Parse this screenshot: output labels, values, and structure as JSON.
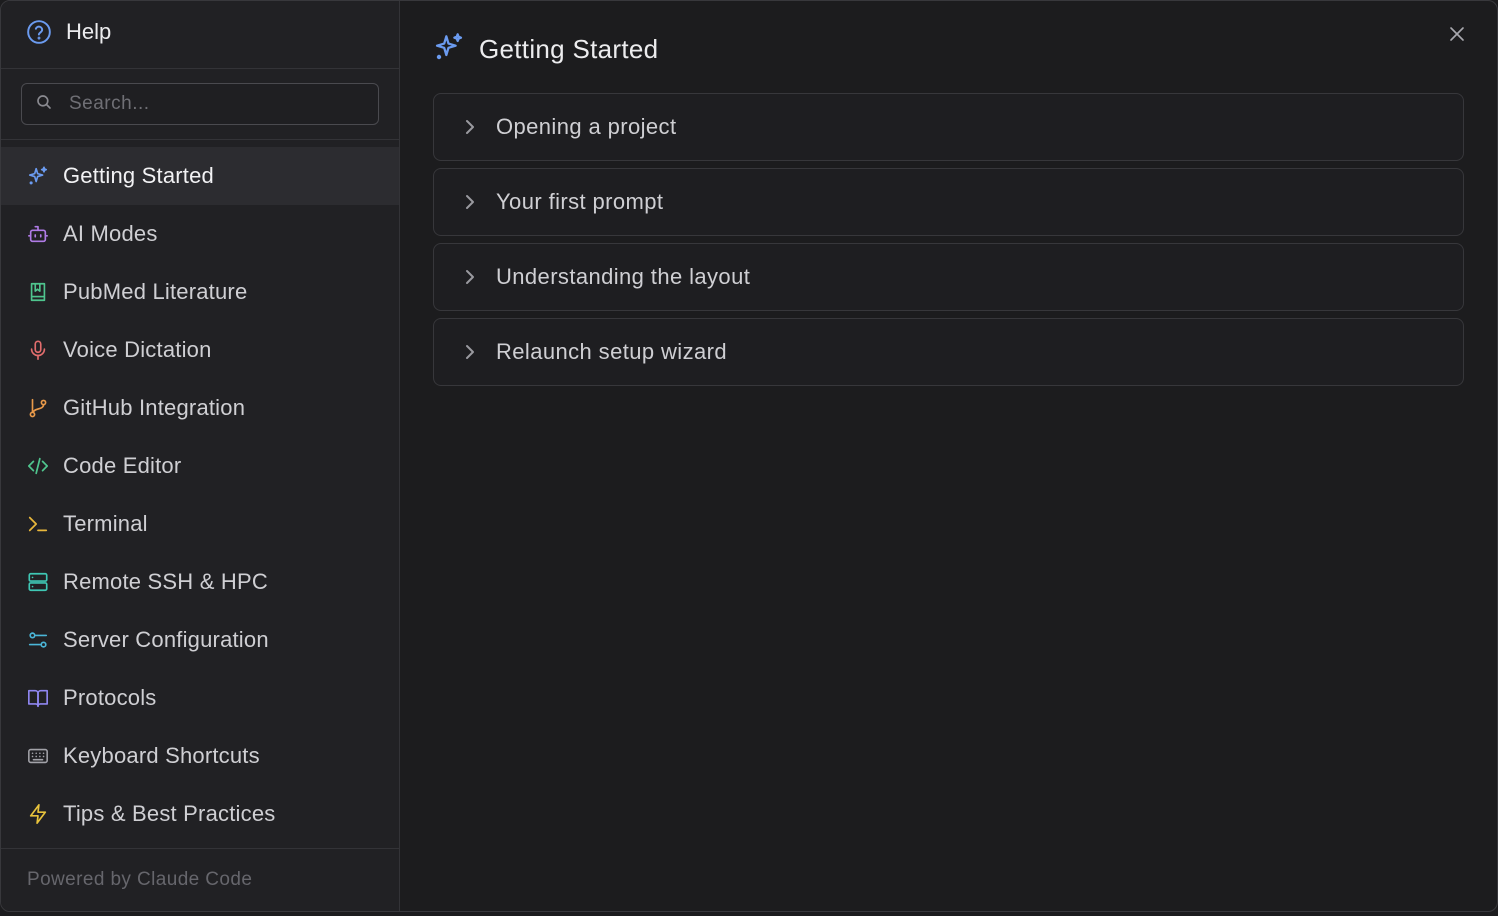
{
  "sidebar": {
    "title": "Help",
    "search_placeholder": "Search...",
    "items": [
      {
        "label": "Getting Started",
        "icon": "sparkles-icon",
        "color": "#6b9bf0",
        "active": true
      },
      {
        "label": "AI Modes",
        "icon": "bot-icon",
        "color": "#b07be6"
      },
      {
        "label": "PubMed Literature",
        "icon": "book-bookmark-icon",
        "color": "#4fc58e"
      },
      {
        "label": "Voice Dictation",
        "icon": "microphone-icon",
        "color": "#e26d6d"
      },
      {
        "label": "GitHub Integration",
        "icon": "git-branch-icon",
        "color": "#e99a4a"
      },
      {
        "label": "Code Editor",
        "icon": "code-icon",
        "color": "#4fc58e"
      },
      {
        "label": "Terminal",
        "icon": "terminal-icon",
        "color": "#e8b73c"
      },
      {
        "label": "Remote SSH & HPC",
        "icon": "server-icon",
        "color": "#3fc7b4"
      },
      {
        "label": "Server Configuration",
        "icon": "sliders-icon",
        "color": "#4bb6d8"
      },
      {
        "label": "Protocols",
        "icon": "book-open-icon",
        "color": "#8f86f0"
      },
      {
        "label": "Keyboard Shortcuts",
        "icon": "keyboard-icon",
        "color": "#a2a2a8"
      },
      {
        "label": "Tips & Best Practices",
        "icon": "lightning-icon",
        "color": "#e8c33c"
      }
    ],
    "footer": "Powered by Claude Code"
  },
  "main": {
    "title": "Getting Started",
    "sections": [
      {
        "label": "Opening a project"
      },
      {
        "label": "Your first prompt"
      },
      {
        "label": "Understanding the layout"
      },
      {
        "label": "Relaunch setup wizard"
      }
    ]
  },
  "colors": {
    "accent": "#6b9bf0",
    "help_icon": "#6b9bf0"
  }
}
